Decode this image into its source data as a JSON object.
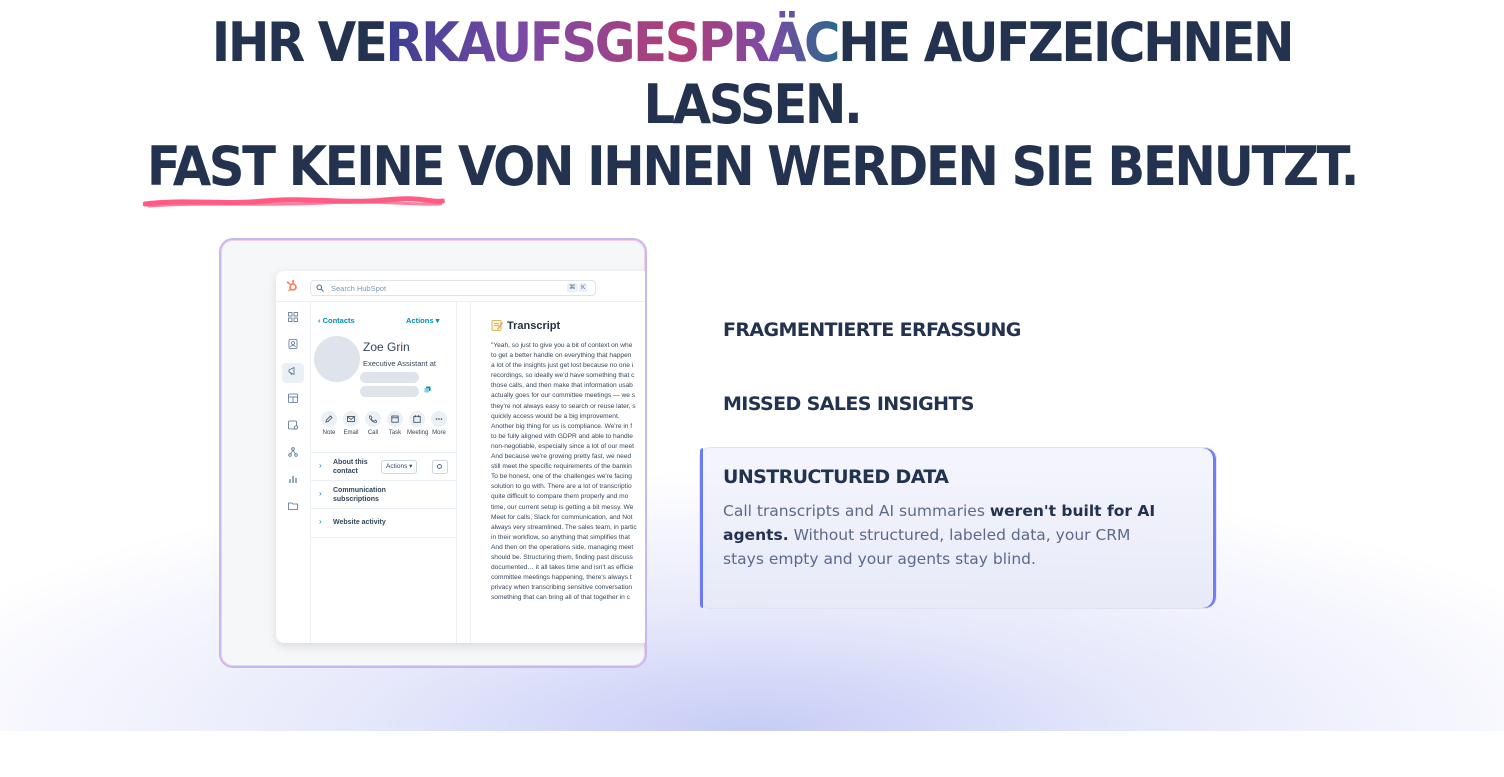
{
  "headline": {
    "line1_part1": "IHR VE",
    "line1_gradient": "RKAUFSGESPRÄC",
    "line1_part2": "HE AUFZEICHNEN",
    "line2": "LASSEN.",
    "line3_underlined": "FAST KEINE",
    "line3_rest": " VON IHNEN WERDEN SIE BENUTZT."
  },
  "colors": {
    "headline": "#23324f",
    "underline_scribble": "#ff5c85",
    "card_border": "#c9b8f0",
    "active_accent": "#6b7cf0",
    "hubspot_orange": "#ff7a59",
    "link_teal": "#0091ae"
  },
  "app": {
    "search_placeholder": "Search HubSpot",
    "kbd1": "⌘",
    "kbd2": "K",
    "breadcrumb": "‹  Contacts",
    "actions": "Actions ▾",
    "contact_name": "Zoe Grin",
    "contact_title": "Executive Assistant at",
    "quick_actions": [
      "Note",
      "Email",
      "Call",
      "Task",
      "Meeting",
      "More"
    ],
    "sections": [
      {
        "title_l1": "About this",
        "title_l2": "contact"
      },
      {
        "title_l1": "Communication",
        "title_l2": "subscriptions"
      },
      {
        "title_l1": "Website activity",
        "title_l2": ""
      }
    ],
    "section_actions": "Actions ▾",
    "transcript_title": "Transcript",
    "transcript_lines": [
      "\"Yeah, so just to give you a bit of context on whe",
      "to get a better handle on everything that happen",
      "a lot of the insights just get lost because no one i",
      "recordings, so ideally we'd have something that c",
      "those calls, and then make that information usab",
      "actually goes for our committee meetings — we s",
      "they're not always easy to search or reuse later, s",
      "quickly access would be a big improvement.",
      "Another big thing for us is compliance. We're in f",
      "to be fully aligned with GDPR and able to handle",
      "non-negotiable, especially since a lot of our meet",
      "And because we're growing pretty fast, we need",
      "still meet the specific requirements of the bankin",
      "To be honest, one of the challenges we're facing",
      "solution to go with. There are a lot of transcriptio",
      "quite difficult to compare them properly and mo",
      "time, our current setup is getting a bit messy. We",
      "Meet for calls, Slack for communication, and Not",
      "always very streamlined. The sales team, in partic",
      "in their workflow, so anything that simplifies that",
      "And then on the operations side, managing meet",
      "should be. Structuring them, finding past discuss",
      "documented… it all takes time and isn't as efficie",
      "committee meetings happening, there's always t",
      "privacy when transcribing sensitive conversation",
      "something that can bring all of that together in c"
    ]
  },
  "features": [
    {
      "title": "FRAGMENTIERTE ERFASSUNG"
    },
    {
      "title": "MISSED SALES INSIGHTS"
    },
    {
      "title": "UNSTRUCTURED DATA",
      "desc_part1": "Call transcripts and AI summaries ",
      "desc_bold": "weren't built for AI agents.",
      "desc_part2": " Without structured, labeled data, your CRM stays empty and your agents stay blind."
    }
  ]
}
